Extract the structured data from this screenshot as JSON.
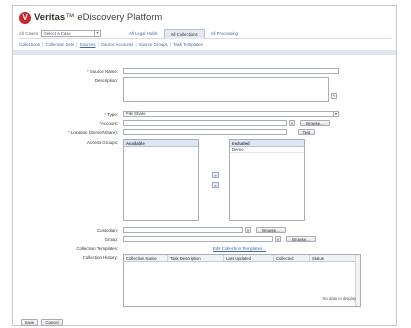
{
  "header": {
    "brand_name": "Veritas",
    "brand_tm": "™",
    "product": "eDiscovery Platform",
    "logo_letter": "V"
  },
  "topnav": {
    "all_cases_label": "All Cases",
    "case_select_value": "Select a Case",
    "tabs": [
      {
        "label": "All Legal Holds",
        "active": false
      },
      {
        "label": "All Collections",
        "active": true
      },
      {
        "label": "All Processing",
        "active": false
      }
    ]
  },
  "subnav": {
    "items": [
      {
        "label": "Collections",
        "active": false
      },
      {
        "label": "Collection Sets",
        "active": false
      },
      {
        "label": "Sources",
        "active": true
      },
      {
        "label": "Source Accounts",
        "active": false
      },
      {
        "label": "Source Groups",
        "active": false
      },
      {
        "label": "Task Templates",
        "active": false
      }
    ]
  },
  "form": {
    "source_name_label": "Source Name:",
    "source_name_value": "",
    "description_label": "Description:",
    "type_label": "Type:",
    "type_value": "File Share",
    "account_label": "Account:",
    "browse_label": "Browse...",
    "location_label": "Location (Server\\share):",
    "test_label": "Test",
    "access_groups_label": "Access Groups:",
    "available_header": "Available",
    "included_header": "Included",
    "included_items": [
      "Demo"
    ],
    "move_right_label": "»",
    "move_left_label": "«",
    "custodian_label": "Custodian:",
    "group_label": "Group:",
    "collection_templates_label": "Collection Templates:",
    "edit_templates_link": "Edit Collection Templates...",
    "collection_history_label": "Collection History:",
    "history_columns": [
      "Collection Name",
      "Task Description",
      "Last Updated",
      "Collected",
      "Status"
    ],
    "no_data_text": "No data to display"
  },
  "footer": {
    "save_label": "Save",
    "cancel_label": "Cancel"
  },
  "colors": {
    "brand_red": "#c8262d",
    "link_blue": "#4466aa",
    "header_bar": "#dfe6ef"
  }
}
